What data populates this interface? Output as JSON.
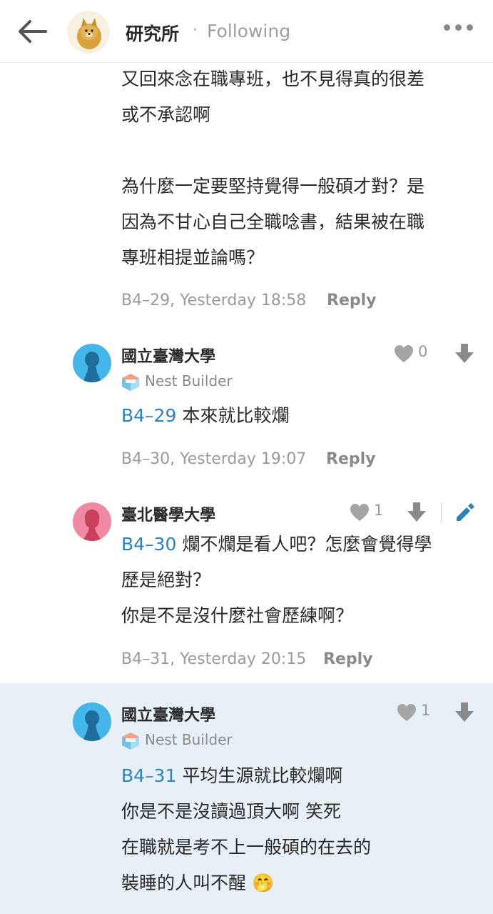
{
  "header": {
    "title": "研究所",
    "separator": "·",
    "follow_status": "Following"
  },
  "post": {
    "lines": [
      "又回來念在職專班，也不見得真的很差",
      "或不承認啊",
      "為什麼一定要堅持覺得一般碩才對？是",
      "因為不甘心自己全職唸書，結果被在職",
      "專班相提並論嗎？"
    ],
    "meta": "B4–29, Yesterday 18:58",
    "reply_label": "Reply"
  },
  "comments": [
    {
      "author": "國立臺灣大學",
      "badge": "Nest Builder",
      "likes": "0",
      "ref": "B4–29",
      "lines": [
        " 本來就比較爛"
      ],
      "meta": "B4–30, Yesterday 19:07",
      "reply_label": "Reply",
      "avatar_color": "#45b6ea"
    },
    {
      "author": "臺北醫學大學",
      "likes": "1",
      "ref": "B4–30",
      "lines": [
        " 爛不爛是看人吧？怎麼會覺得學",
        "歷是絕對？",
        "你是不是沒什麼社會歷練啊？"
      ],
      "meta": "B4–31, Yesterday 20:15",
      "reply_label": "Reply",
      "avatar_color": "#f08aa3"
    },
    {
      "author": "國立臺灣大學",
      "badge": "Nest Builder",
      "likes": "1",
      "ref": "B4–31",
      "lines": [
        " 平均生源就比較爛啊",
        "你是不是沒讀過頂大啊 笑死",
        "在職就是考不上一般碩的在去的",
        "裝睡的人叫不醒"
      ],
      "emoji": "🤭",
      "avatar_color": "#45b6ea"
    }
  ],
  "colors": {
    "link": "#2e82b8",
    "highlight_bg": "#e8f0f7",
    "icon_gray": "#8a8a8a"
  }
}
